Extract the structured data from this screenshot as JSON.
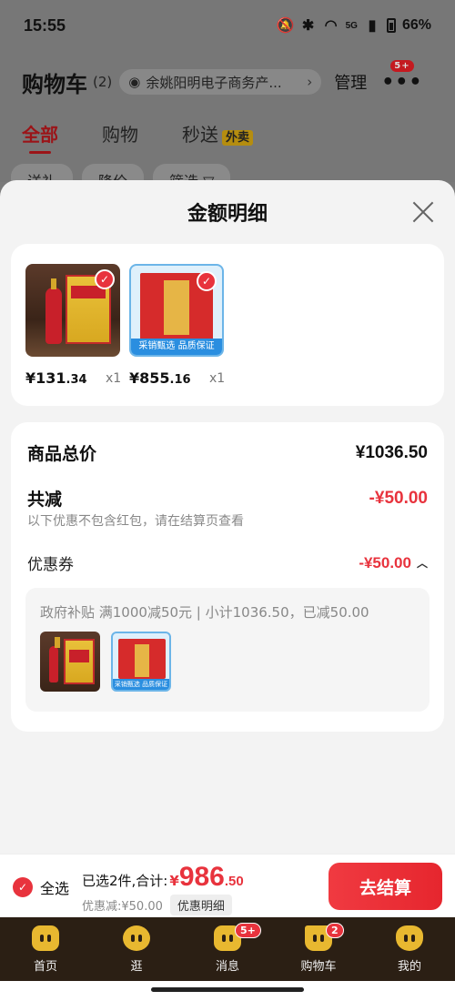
{
  "status_bar": {
    "time": "15:55",
    "network": "5G",
    "battery": "66%"
  },
  "background": {
    "title": "购物车",
    "count": "(2)",
    "store": "余姚阳明电子商务产...",
    "manage": "管理",
    "more_badge": "5+",
    "tabs": [
      "全部",
      "购物",
      "秒送"
    ],
    "tab_tag": "外卖",
    "filters": [
      "送礼",
      "降价",
      "筛选 ▽"
    ]
  },
  "sheet": {
    "title": "金额明细",
    "products": [
      {
        "price_int": "¥131",
        "price_dec": ".34",
        "qty": "x1"
      },
      {
        "price_int": "¥855",
        "price_dec": ".16",
        "qty": "x1",
        "band": "采销甄选  品质保证"
      }
    ],
    "total_label": "商品总价",
    "total_value": "¥1036.50",
    "reduce_label": "共减",
    "reduce_value": "-¥50.00",
    "reduce_note": "以下优惠不包含红包，请在结算页查看",
    "coupon_label": "优惠券",
    "coupon_value": "-¥50.00",
    "coupon_detail": "政府补贴 满1000减50元 | 小计1036.50，已减50.00",
    "thumb_band": "采销甄选  品质保证"
  },
  "checkout": {
    "select_all": "全选",
    "selected_prefix": "已选2件,合计:",
    "yen": "¥",
    "total_int": "986",
    "total_dec": ".50",
    "discount": "优惠减:¥50.00",
    "detail_button": "优惠明细",
    "checkout_button": "去结算"
  },
  "tabbar": {
    "items": [
      {
        "label": "首页",
        "icon": "home-icon"
      },
      {
        "label": "逛",
        "icon": "browse-icon"
      },
      {
        "label": "消息",
        "icon": "message-icon",
        "badge": "5+"
      },
      {
        "label": "购物车",
        "icon": "cart-icon",
        "badge": "2"
      },
      {
        "label": "我的",
        "icon": "profile-icon"
      }
    ]
  },
  "colors": {
    "accent": "#e8333d",
    "tabbar_bg": "#2b1f14",
    "icon_gold": "#e8b830"
  }
}
